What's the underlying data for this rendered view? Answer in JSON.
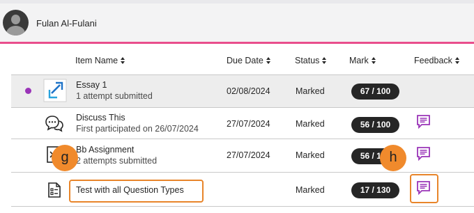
{
  "user": {
    "name": "Fulan Al-Fulani",
    "avatar_icon": "user-avatar-icon"
  },
  "columns": {
    "item_name": "Item Name",
    "due_date": "Due Date",
    "status": "Status",
    "mark": "Mark",
    "feedback": "Feedback"
  },
  "rows": [
    {
      "icon": "assignment-arrow-icon",
      "title": "Essay 1",
      "subtitle": "1 attempt submitted",
      "due": "02/08/2024",
      "status": "Marked",
      "mark": "67 / 100",
      "new_indicator": true,
      "feedback": false
    },
    {
      "icon": "discussion-bubble-icon",
      "title": "Discuss This",
      "subtitle": "First participated on 26/07/2024",
      "due": "27/07/2024",
      "status": "Marked",
      "mark": "56 / 100",
      "new_indicator": false,
      "feedback": true
    },
    {
      "icon": "assignment-document-icon",
      "title": "Bb Assignment",
      "subtitle": "2 attempts submitted",
      "due": "27/07/2024",
      "status": "Marked",
      "mark": "56 / 100",
      "new_indicator": false,
      "feedback": true
    },
    {
      "icon": "test-document-icon",
      "title": "Test with all Question Types",
      "subtitle": "",
      "due": "",
      "status": "Marked",
      "mark": "17 / 130",
      "new_indicator": false,
      "feedback": true
    }
  ],
  "callouts": {
    "g": "g",
    "h": "h"
  },
  "colors": {
    "accent_pink": "#e94e8c",
    "purple": "#9a34b8",
    "highlight_orange": "#e8852a",
    "pill_dark": "#262626"
  }
}
